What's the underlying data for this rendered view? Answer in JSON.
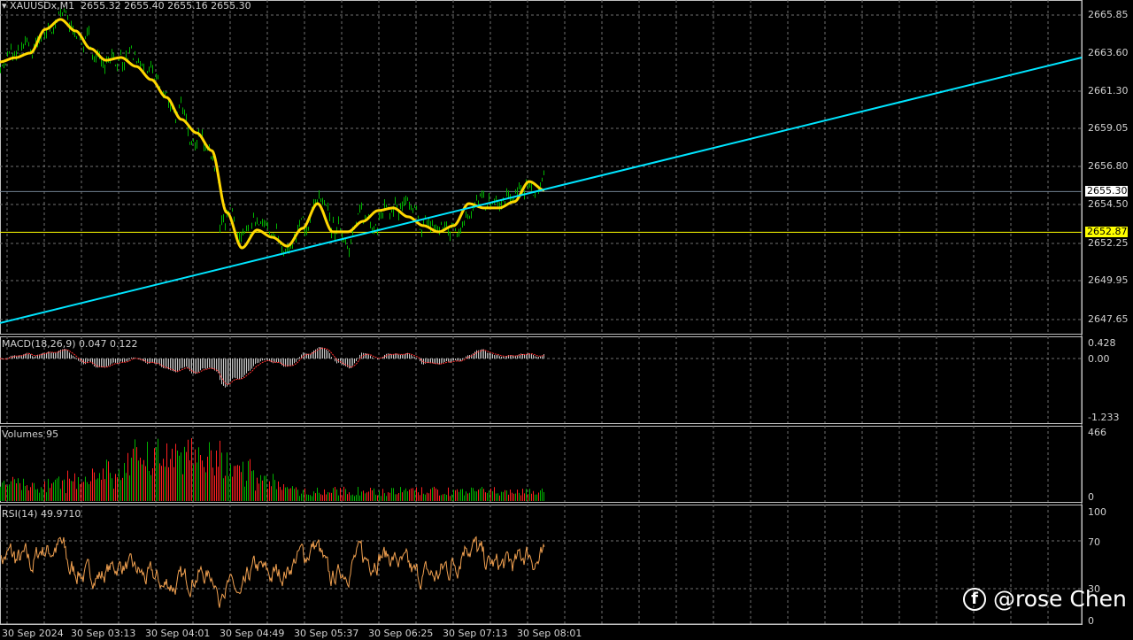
{
  "header": {
    "symbol": "XAUUSDx,M1",
    "ohlc": "2655.32 2655.40 2655.16 2655.30"
  },
  "price_axis": [
    "2665.85",
    "2663.60",
    "2661.30",
    "2659.05",
    "2656.80",
    "2654.50",
    "2652.25",
    "2649.95",
    "2647.65"
  ],
  "current_price_tag": "2655.30",
  "level_tag": "2652.87",
  "macd": {
    "label": "MACD(18,26,9) 0.047 0.122",
    "axis": [
      "0.428",
      "0.00",
      "-1.233"
    ]
  },
  "volumes": {
    "label": "Volumes 95",
    "axis": [
      "466",
      "0"
    ]
  },
  "rsi": {
    "label": "RSI(14) 49.9710",
    "axis": [
      "100",
      "70",
      "30",
      "0"
    ]
  },
  "time_axis": [
    "30 Sep 2024",
    "30 Sep 03:13",
    "30 Sep 04:01",
    "30 Sep 04:49",
    "30 Sep 05:37",
    "30 Sep 06:25",
    "30 Sep 07:13",
    "30 Sep 08:01"
  ],
  "watermark": "@rose Chen",
  "colors": {
    "ma": "#ffd700",
    "trend": "#00e5ff",
    "level": "#ffff00",
    "up": "#00b400",
    "down": "#ff2020",
    "rsi": "#f0a050"
  },
  "chart_data": {
    "type": "line",
    "title": "XAUUSDx,M1",
    "ylim": [
      2646.9,
      2666.8
    ],
    "ma_keypoints": [
      2663.05,
      2663.3,
      2663.58,
      2665.0,
      2665.59,
      2664.9,
      2663.84,
      2663.15,
      2663.31,
      2662.78,
      2661.99,
      2660.93,
      2659.61,
      2658.81,
      2657.75,
      2654.05,
      2651.93,
      2653.0,
      2652.57,
      2652.04,
      2653.1,
      2654.58,
      2652.89,
      2652.89,
      2653.52,
      2654.16,
      2654.32,
      2653.79,
      2653.26,
      2652.89,
      2653.26,
      2654.58,
      2654.32,
      2654.32,
      2654.69,
      2655.9,
      2655.38
    ],
    "trendline": [
      2647.44,
      2663.31
    ],
    "horizontal_levels": [
      2655.3,
      2652.87
    ]
  }
}
